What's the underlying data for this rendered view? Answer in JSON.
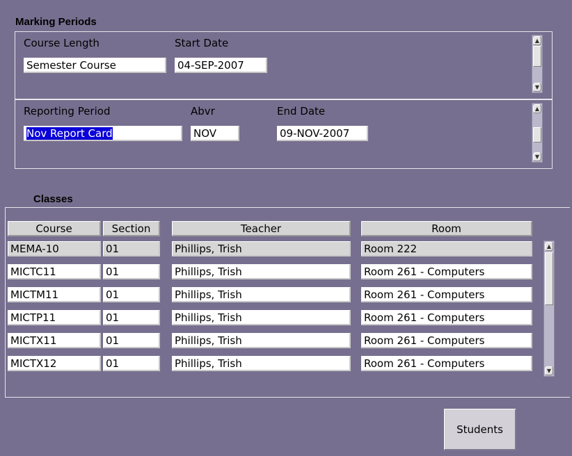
{
  "marking_periods": {
    "title": "Marking Periods",
    "course_length_label": "Course Length",
    "start_date_label": "Start Date",
    "course_length_value": "Semester Course",
    "start_date_value": "04-SEP-2007",
    "reporting_period_label": "Reporting Period",
    "abvr_label": "Abvr",
    "end_date_label": "End Date",
    "reporting_period_value": "Nov Report Card",
    "abvr_value": "NOV",
    "end_date_value": "09-NOV-2007"
  },
  "classes": {
    "title": "Classes",
    "headers": {
      "course": "Course",
      "section": "Section",
      "teacher": "Teacher",
      "room": "Room"
    },
    "rows": [
      {
        "course": "MEMA-10",
        "section": "01",
        "teacher": "Phillips, Trish",
        "room": "Room 222"
      },
      {
        "course": "MICTC11",
        "section": "01",
        "teacher": "Phillips, Trish",
        "room": "Room 261 - Computers"
      },
      {
        "course": "MICTM11",
        "section": "01",
        "teacher": "Phillips, Trish",
        "room": "Room 261 - Computers"
      },
      {
        "course": "MICTP11",
        "section": "01",
        "teacher": "Phillips, Trish",
        "room": "Room 261 - Computers"
      },
      {
        "course": "MICTX11",
        "section": "01",
        "teacher": "Phillips, Trish",
        "room": "Room 261 - Computers"
      },
      {
        "course": "MICTX12",
        "section": "01",
        "teacher": "Phillips, Trish",
        "room": "Room 261 - Computers"
      }
    ]
  },
  "buttons": {
    "students": "Students"
  },
  "colors": {
    "background": "#776f8f",
    "selection": "#0a00d8",
    "current_row": "#d6d6d6"
  },
  "icons": {
    "scroll_up": "up-arrow-icon",
    "scroll_down": "down-arrow-icon"
  }
}
